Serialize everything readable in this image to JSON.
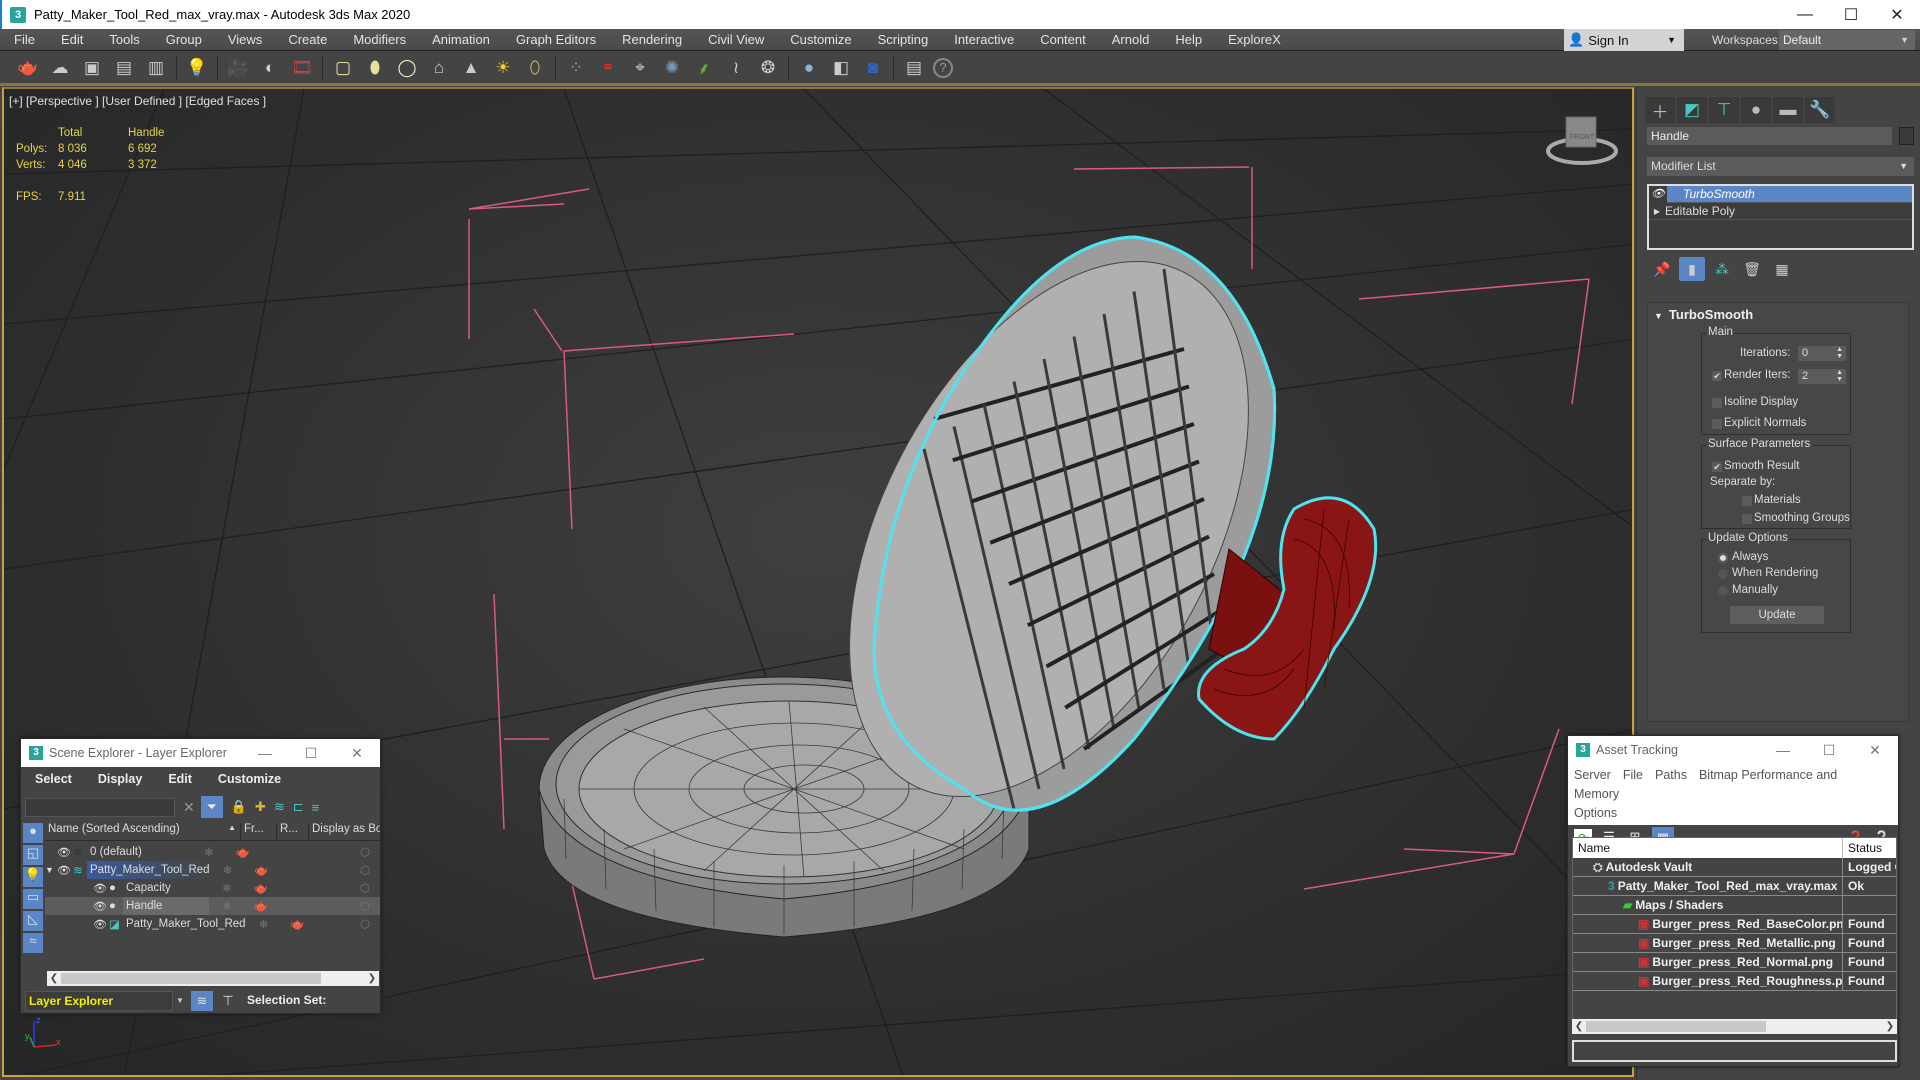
{
  "window": {
    "title": "Patty_Maker_Tool_Red_max_vray.max - Autodesk 3ds Max 2020",
    "app_icon": "3",
    "controls": {
      "minimize": "—",
      "maximize": "☐",
      "close": "✕"
    }
  },
  "menubar": {
    "items": [
      "File",
      "Edit",
      "Tools",
      "Group",
      "Views",
      "Create",
      "Modifiers",
      "Animation",
      "Graph Editors",
      "Rendering",
      "Civil View",
      "Customize",
      "Scripting",
      "Interactive",
      "Content",
      "Arnold",
      "Help",
      "ExploreX"
    ],
    "sign_in": "Sign In",
    "workspaces_label": "Workspaces:",
    "workspace": "Default"
  },
  "toolbar": {
    "icons": [
      "teapot-icon",
      "cloud-icon",
      "render-frame-icon",
      "render-setup-icon",
      "render-setup-alt-icon",
      "light-lister-icon",
      "camera-icon",
      "camera-sequencer-icon",
      "video-post-icon",
      "box-icon",
      "sphere-icon",
      "geosphere-icon",
      "teapot-wire-icon",
      "cone-icon",
      "sun-icon",
      "egg-icon",
      "particles-icon",
      "dumbbell-icon",
      "compass-icon",
      "scatter-icon",
      "grass-icon",
      "hair-icon",
      "fur-icon",
      "material-sphere-icon",
      "material-editor-icon",
      "render-region-icon",
      "scene-states-icon",
      "help-icon"
    ]
  },
  "viewport": {
    "label": "[+] [Perspective ] [User Defined ] [Edged Faces ]",
    "stats": {
      "col_total": "Total",
      "col_selected": "Handle",
      "polys_label": "Polys:",
      "polys_total": "8 036",
      "polys_selected": "6 692",
      "verts_label": "Verts:",
      "verts_total": "4 046",
      "verts_selected": "3 372",
      "fps_label": "FPS:",
      "fps": "7.911"
    },
    "viewcube_face": "FRONT",
    "axis": {
      "x": "x",
      "y": "y",
      "z": "z"
    }
  },
  "command_panel": {
    "tabs": [
      "create-tab",
      "modify-tab",
      "hierarchy-tab",
      "motion-tab",
      "display-tab",
      "utilities-tab"
    ],
    "object_name": "Handle",
    "modifier_list": "Modifier List",
    "stack": [
      {
        "name": "TurboSmooth",
        "selected": true
      },
      {
        "name": "Editable Poly",
        "selected": false
      }
    ],
    "turbosmooth": {
      "title": "TurboSmooth",
      "main_label": "Main",
      "iterations_label": "Iterations:",
      "iterations": "0",
      "render_iters_label": "Render Iters:",
      "render_iters": "2",
      "render_iters_checked": true,
      "isoline_display": "Isoline Display",
      "explicit_normals": "Explicit Normals",
      "surface_label": "Surface Parameters",
      "smooth_result": "Smooth Result",
      "separate_by": "Separate by:",
      "materials": "Materials",
      "smoothing_groups": "Smoothing Groups",
      "update_label": "Update Options",
      "always": "Always",
      "when_rendering": "When Rendering",
      "manually": "Manually",
      "update_button": "Update"
    }
  },
  "scene_explorer": {
    "title": "Scene Explorer - Layer Explorer",
    "menu": [
      "Select",
      "Display",
      "Edit",
      "Customize"
    ],
    "columns": {
      "name": "Name (Sorted Ascending)",
      "frozen": "Fr...",
      "render": "R...",
      "display_box": "Display as Box"
    },
    "rows": [
      {
        "name": "0 (default)",
        "level": 0,
        "type": "layer",
        "highlight": false
      },
      {
        "name": "Patty_Maker_Tool_Red",
        "level": 0,
        "type": "layer-active",
        "highlight": "blue"
      },
      {
        "name": "Capacity",
        "level": 1,
        "type": "object",
        "highlight": false
      },
      {
        "name": "Handle",
        "level": 1,
        "type": "object",
        "highlight": "grey"
      },
      {
        "name": "Patty_Maker_Tool_Red",
        "level": 1,
        "type": "group",
        "highlight": false
      }
    ],
    "footer_dropdown": "Layer Explorer",
    "selection_set_label": "Selection Set:"
  },
  "asset_tracking": {
    "title": "Asset Tracking",
    "menu": [
      "Server",
      "File",
      "Paths",
      "Bitmap Performance and Memory",
      "Options"
    ],
    "columns": {
      "name": "Name",
      "status": "Status"
    },
    "rows": [
      {
        "name": "Autodesk Vault",
        "status": "Logged Out",
        "level": 0,
        "icon": "vault-icon"
      },
      {
        "name": "Patty_Maker_Tool_Red_max_vray.max",
        "status": "Ok",
        "level": 1,
        "icon": "max-file-icon"
      },
      {
        "name": "Maps / Shaders",
        "status": "",
        "level": 2,
        "icon": "maps-icon"
      },
      {
        "name": "Burger_press_Red_BaseColor.png",
        "status": "Found",
        "level": 3,
        "icon": "png-icon"
      },
      {
        "name": "Burger_press_Red_Metallic.png",
        "status": "Found",
        "level": 3,
        "icon": "png-icon"
      },
      {
        "name": "Burger_press_Red_Normal.png",
        "status": "Found",
        "level": 3,
        "icon": "png-icon"
      },
      {
        "name": "Burger_press_Red_Roughness.png",
        "status": "Found",
        "level": 3,
        "icon": "png-icon"
      }
    ]
  },
  "colors": {
    "accent_teal": "#4ac7c0",
    "selection_blue": "#5a86c5",
    "stats_yellow": "#e8d24a",
    "viewport_border": "#c9a23a",
    "handle_red": "#7a1010",
    "selection_outline": "#4fe3ee"
  }
}
